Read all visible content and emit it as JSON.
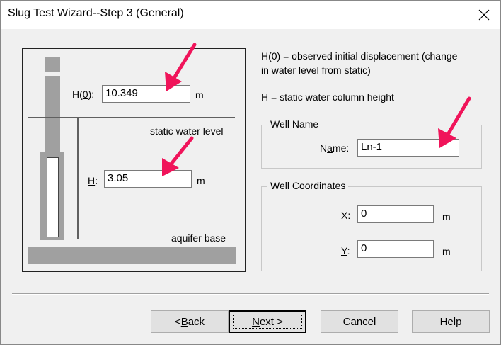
{
  "window": {
    "title": "Slug Test Wizard--Step 3 (General)"
  },
  "diagram": {
    "h0_label_pre": "H(",
    "h0_label_ul": "0",
    "h0_label_post": "):",
    "h0_value": "10.349",
    "h0_unit": "m",
    "static_water_level": "static water level",
    "h_label_ul": "H",
    "h_label_post": ":",
    "h_value": "3.05",
    "h_unit": "m",
    "aquifer_base": "aquifer base"
  },
  "description": {
    "line1": "H(0) = observed initial displacement (change",
    "line2": "in water level from static)",
    "line3": "H = static water column height"
  },
  "well_name": {
    "legend": "Well Name",
    "label_pre": "N",
    "label_ul": "a",
    "label_post": "me:",
    "value": "Ln-1"
  },
  "well_coordinates": {
    "legend": "Well Coordinates",
    "x_label_ul": "X",
    "x_label_post": ":",
    "x_value": "0",
    "x_unit": "m",
    "y_label_ul": "Y",
    "y_label_post": ":",
    "y_value": "0",
    "y_unit": "m"
  },
  "buttons": {
    "back_pre": "< ",
    "back_ul": "B",
    "back_post": "ack",
    "next_ul": "N",
    "next_post": "ext >",
    "cancel": "Cancel",
    "help": "Help"
  },
  "icons": {
    "close": "close-icon"
  },
  "colors": {
    "annotation_arrow": "#f0145a"
  }
}
